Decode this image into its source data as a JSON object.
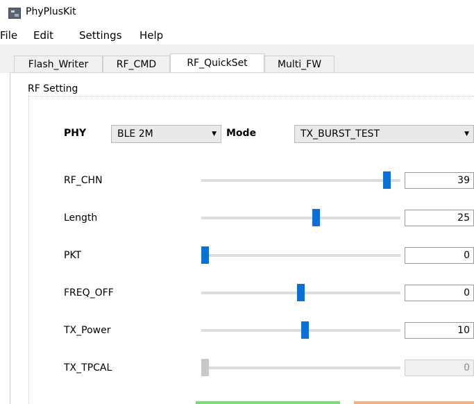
{
  "window": {
    "title": "PhyPlusKit"
  },
  "menu": [
    "File",
    "Edit",
    "Settings",
    "Help"
  ],
  "tabs": [
    {
      "label": "Flash_Writer",
      "active": false
    },
    {
      "label": "RF_CMD",
      "active": false
    },
    {
      "label": "RF_QuickSet",
      "active": true
    },
    {
      "label": "Multi_FW",
      "active": false
    }
  ],
  "group": {
    "title": "RF Setting",
    "phy": {
      "label": "PHY",
      "value": "BLE 2M"
    },
    "mode": {
      "label": "Mode",
      "value": "TX_BURST_TEST"
    }
  },
  "rows": [
    {
      "label": "RF_CHN",
      "value": "39",
      "enabled": true,
      "slider_fraction": 0.95
    },
    {
      "label": "Length",
      "value": "25",
      "enabled": true,
      "slider_fraction": 0.58
    },
    {
      "label": "PKT",
      "value": "0",
      "enabled": true,
      "slider_fraction": 0.0
    },
    {
      "label": "FREQ_OFF",
      "value": "0",
      "enabled": true,
      "slider_fraction": 0.5
    },
    {
      "label": "TX_Power",
      "value": "10",
      "enabled": true,
      "slider_fraction": 0.52
    },
    {
      "label": "TX_TPCAL",
      "value": "0",
      "enabled": false,
      "slider_fraction": 0.0
    }
  ]
}
